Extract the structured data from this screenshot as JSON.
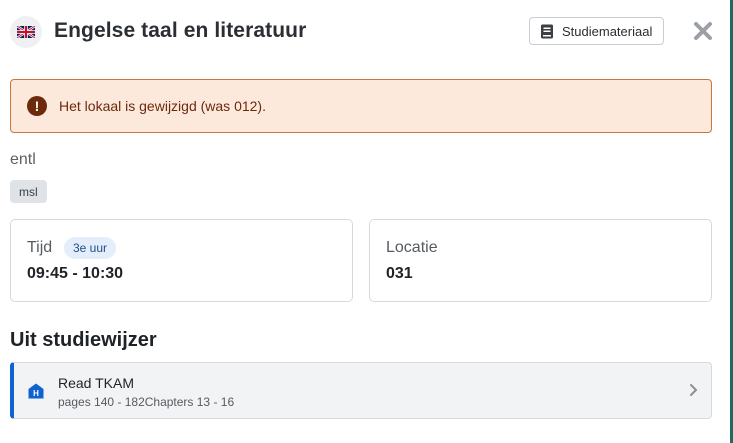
{
  "header": {
    "flag_icon": "uk-flag-icon",
    "title": "Engelse taal en literatuur",
    "study_material_button": "Studiemateriaal",
    "study_material_icon": "book-icon",
    "close_icon": "close-icon"
  },
  "alert": {
    "icon": "exclamation-circle-icon",
    "text": "Het lokaal is gewijzigd (was 012)."
  },
  "course": {
    "code": "entl",
    "tag": "msl"
  },
  "time_card": {
    "label": "Tijd",
    "period_badge": "3e uur",
    "value": "09:45 - 10:30"
  },
  "location_card": {
    "label": "Locatie",
    "value": "031"
  },
  "studiewijzer": {
    "section_title": "Uit studiewijzer",
    "items": [
      {
        "icon": "homework-icon",
        "title": "Read TKAM",
        "subtitle": "pages 140 - 182Chapters 13 - 16"
      }
    ]
  },
  "colors": {
    "alert_background": "#fde8dc",
    "alert_border": "#c9773f",
    "alert_text": "#6b2a0c",
    "accent_blue": "#1062d0",
    "badge_background": "#e4eefb"
  }
}
